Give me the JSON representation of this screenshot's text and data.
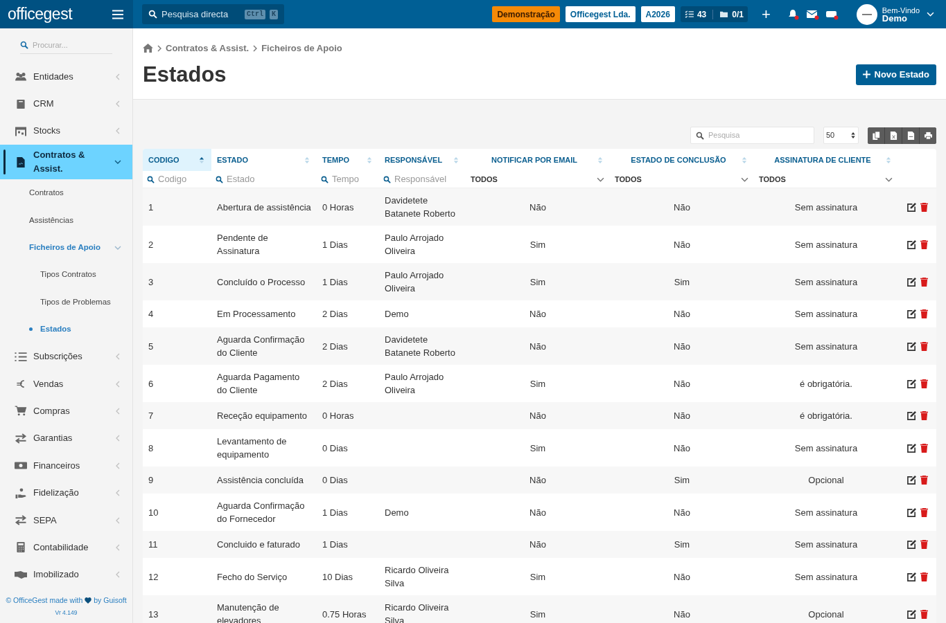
{
  "topbar": {
    "logo": "officegest",
    "search": {
      "placeholder": "Pesquisa directa",
      "keys": [
        "Ctrl",
        "K"
      ]
    },
    "badges": [
      {
        "label": "Demonstração",
        "kind": "warning"
      },
      {
        "label": "Officegest Lda.",
        "kind": "light"
      },
      {
        "label": "A2026",
        "kind": "light"
      }
    ],
    "counters": [
      "43",
      "0/1"
    ],
    "add": "+",
    "notifications": [
      {
        "unread": true
      },
      {
        "unread": true
      },
      {
        "unread": true
      }
    ],
    "user": {
      "greeting": "Bem-Vindo",
      "name": "Demo"
    }
  },
  "sidebar": {
    "search": {
      "placeholder": "Procurar..."
    },
    "items": [
      {
        "label": "Entidades",
        "selected": false,
        "expanded": false
      },
      {
        "label": "CRM",
        "selected": false,
        "expanded": false
      },
      {
        "label": "Stocks",
        "selected": false,
        "expanded": false
      },
      {
        "label": "Contratos & Assist.",
        "selected": true,
        "expanded": true,
        "children": [
          {
            "label": "Contratos",
            "selected": false
          },
          {
            "label": "Assistências",
            "selected": false
          },
          {
            "label": "Ficheiros de Apoio",
            "selected": true,
            "expanded": true,
            "children": [
              {
                "label": "Tipos Contratos",
                "selected": false
              },
              {
                "label": "Tipos de Problemas",
                "selected": false
              },
              {
                "label": "Estados",
                "selected": true
              }
            ]
          }
        ]
      },
      {
        "label": "Subscrições",
        "selected": false,
        "expanded": false
      },
      {
        "label": "Vendas",
        "selected": false,
        "expanded": false
      },
      {
        "label": "Compras",
        "selected": false,
        "expanded": false
      },
      {
        "label": "Garantias",
        "selected": false,
        "expanded": false
      },
      {
        "label": "Financeiros",
        "selected": false,
        "expanded": false
      },
      {
        "label": "Fidelização",
        "selected": false,
        "expanded": false
      },
      {
        "label": "SEPA",
        "selected": false,
        "expanded": false
      },
      {
        "label": "Contabilidade",
        "selected": false,
        "expanded": false
      },
      {
        "label": "Imobilizado",
        "selected": false,
        "expanded": false
      }
    ],
    "footer": {
      "before": "© OfficeGest made with",
      "after": "by Guisoft",
      "version": "Vr 4.149"
    }
  },
  "breadcrumb": [
    "Contratos & Assist.",
    "Ficheiros de Apoio"
  ],
  "title": "Estados",
  "new_button": "Novo Estado",
  "table_tools": {
    "search": {
      "placeholder": "Pesquisa"
    },
    "page_size": "50"
  },
  "table": {
    "columns": [
      {
        "label": "CODIGO",
        "sorted": true,
        "filter": {
          "kind": "search",
          "placeholder": "Codigo"
        }
      },
      {
        "label": "ESTADO",
        "sorted": false,
        "filter": {
          "kind": "search",
          "placeholder": "Estado"
        }
      },
      {
        "label": "TEMPO",
        "sorted": false,
        "filter": {
          "kind": "search",
          "placeholder": "Tempo"
        }
      },
      {
        "label": "RESPONSÁVEL",
        "sorted": false,
        "filter": {
          "kind": "search",
          "placeholder": "Responsável"
        }
      },
      {
        "label": "NOTIFICAR POR EMAIL",
        "sorted": false,
        "filter": {
          "kind": "select",
          "value": "TODOS"
        }
      },
      {
        "label": "ESTADO DE CONCLUSÃO",
        "sorted": false,
        "filter": {
          "kind": "select",
          "value": "TODOS"
        }
      },
      {
        "label": "ASSINATURA DE CLIENTE",
        "sorted": false,
        "filter": {
          "kind": "select",
          "value": "TODOS"
        }
      }
    ],
    "rows": [
      [
        "1",
        "Abertura de assistência",
        "0 Horas",
        "Davidetete Batanete Roberto",
        "Não",
        "Não",
        "Sem assinatura"
      ],
      [
        "2",
        "Pendente de Assinatura",
        "1 Dias",
        "Paulo Arrojado Oliveira",
        "Sim",
        "Não",
        "Sem assinatura"
      ],
      [
        "3",
        "Concluído o Processo",
        "1 Dias",
        "Paulo Arrojado Oliveira",
        "Sim",
        "Sim",
        "Sem assinatura"
      ],
      [
        "4",
        "Em Processamento",
        "2 Dias",
        "Demo",
        "Não",
        "Não",
        "Sem assinatura"
      ],
      [
        "5",
        "Aguarda Confirmação do Cliente",
        "2 Dias",
        "Davidetete Batanete Roberto",
        "Não",
        "Não",
        "Sem assinatura"
      ],
      [
        "6",
        "Aguarda Pagamento do Cliente",
        "2 Dias",
        "Paulo Arrojado Oliveira",
        "Sim",
        "Não",
        "é obrigatória."
      ],
      [
        "7",
        "Receção equipamento",
        "0 Horas",
        "",
        "Não",
        "Não",
        "é obrigatória."
      ],
      [
        "8",
        "Levantamento de equipamento",
        "0 Dias",
        "",
        "Sim",
        "Não",
        "Sem assinatura"
      ],
      [
        "9",
        "Assistência concluída",
        "0 Dias",
        "",
        "Não",
        "Sim",
        "Opcional"
      ],
      [
        "10",
        "Aguarda Confirmação do Fornecedor",
        "1 Dias",
        "Demo",
        "Não",
        "Não",
        "Sem assinatura"
      ],
      [
        "11",
        "Concluido e faturado",
        "1 Dias",
        "",
        "Não",
        "Sim",
        "Sem assinatura"
      ],
      [
        "12",
        "Fecho do Serviço",
        "10 Dias",
        "Ricardo Oliveira Silva",
        "Sim",
        "Não",
        "Sem assinatura"
      ],
      [
        "13",
        "Manutenção de elevadores",
        "0.75 Horas",
        "Ricardo Oliveira Silva",
        "Sim",
        "Não",
        "Opcional"
      ]
    ]
  }
}
